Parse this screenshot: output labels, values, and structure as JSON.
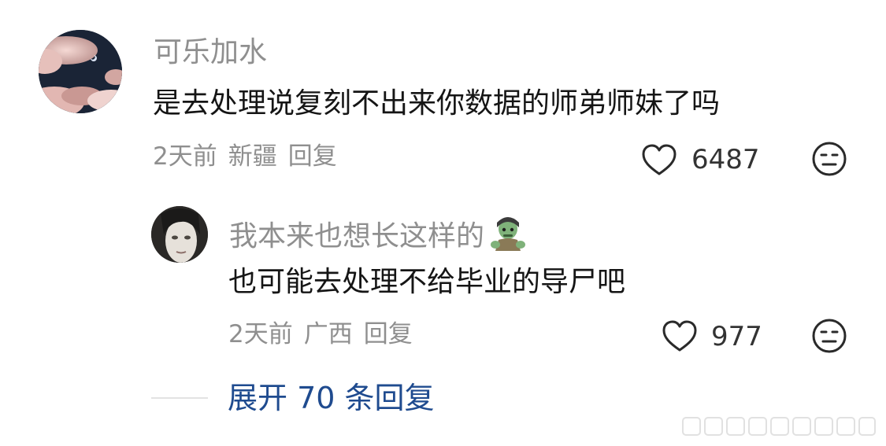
{
  "comment": {
    "username": "可乐加水",
    "text": "是去处理说复刻不出来你数据的师弟师妹了吗",
    "time": "2天前",
    "location": "新疆",
    "reply_label": "回复",
    "likes": "6487"
  },
  "reply": {
    "username": "我本来也想长这样的",
    "emoji": "🧟",
    "text": "也可能去处理不给毕业的导尸吧",
    "time": "2天前",
    "location": "广西",
    "reply_label": "回复",
    "likes": "977"
  },
  "expand_replies": "展开 70 条回复",
  "icons": {
    "like": "heart-outline-icon",
    "dislike": "expressionless-face-icon",
    "watermark": "watermark-logo"
  },
  "colors": {
    "username": "#8f8f8f",
    "meta": "#8f8f8f",
    "text": "#151515",
    "link": "#1f4b8f"
  }
}
